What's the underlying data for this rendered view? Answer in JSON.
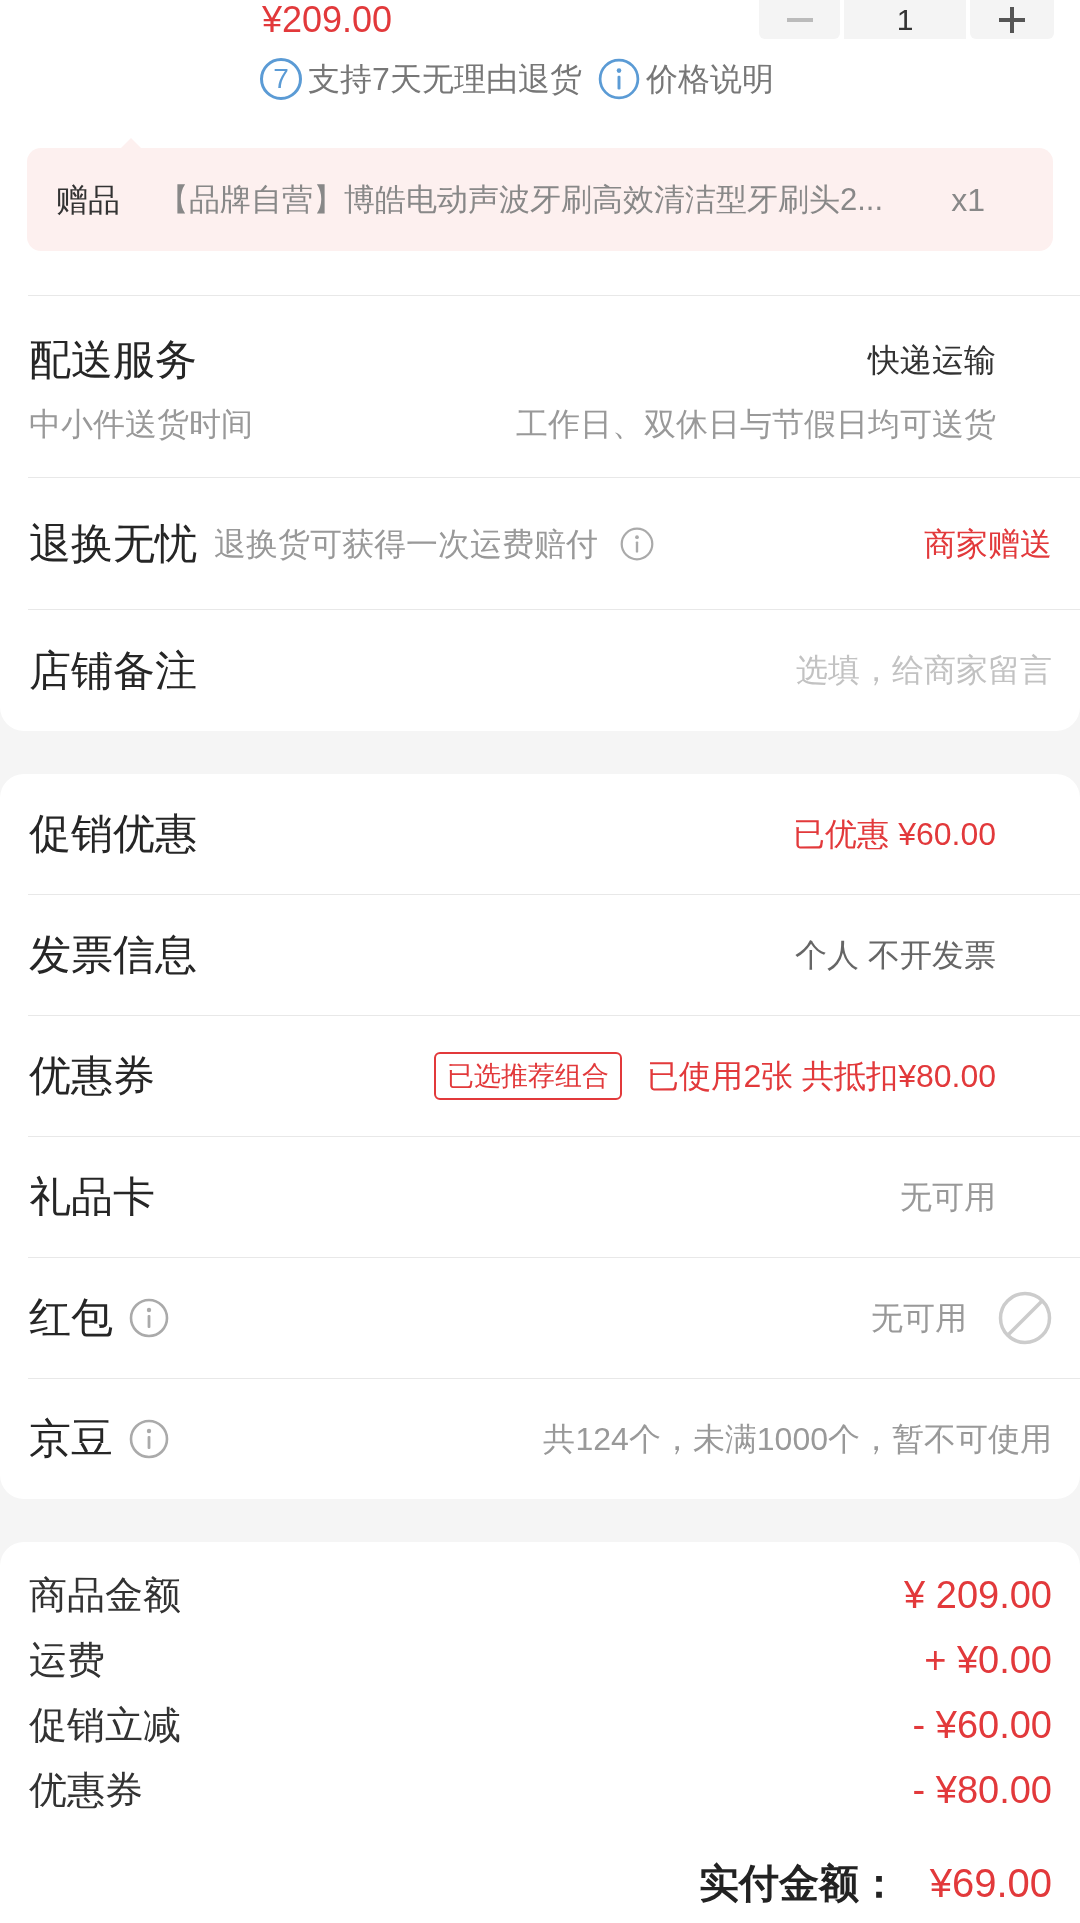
{
  "product": {
    "price": "¥209.00",
    "quantity": "1"
  },
  "service_tags": [
    {
      "kind": "badge",
      "badge": "7",
      "label": "支持7天无理由退货"
    },
    {
      "kind": "info",
      "label": "价格说明"
    }
  ],
  "gift": {
    "label": "赠品",
    "name": "【品牌自营】博皓电动声波牙刷高效清洁型牙刷头2...",
    "quantity": "x1"
  },
  "delivery": {
    "title": "配送服务",
    "value": "快递运输",
    "subtitle": "中小件送货时间",
    "note": "工作日、双休日与节假日均可送货"
  },
  "return_service": {
    "title": "退换无忧",
    "description": "退换货可获得一次运费赔付",
    "info": true,
    "value": "商家赠送"
  },
  "store_note": {
    "title": "店铺备注",
    "placeholder": "选填，给商家留言"
  },
  "benefits": [
    {
      "kind": "link",
      "label": "促销优惠",
      "info": false,
      "value": "已优惠 ¥60.00",
      "color": "#e2393b"
    },
    {
      "kind": "link",
      "label": "发票信息",
      "info": false,
      "value": "个人 不开发票",
      "color": "#666666"
    },
    {
      "kind": "link",
      "label": "优惠券",
      "info": false,
      "tag": "已选推荐组合",
      "value": "已使用2张 共抵扣¥80.00",
      "color": "#e2393b"
    },
    {
      "kind": "link",
      "label": "礼品卡",
      "info": false,
      "value": "无可用",
      "color": "#999999"
    },
    {
      "kind": "toggle",
      "label": "红包",
      "info": true,
      "value": "无可用",
      "color": "#999999",
      "disabled": true
    },
    {
      "kind": "plain",
      "label": "京豆",
      "info": true,
      "value": "共124个，未满1000个，暂不可使用",
      "color": "#999999"
    }
  ],
  "summary": {
    "lines": [
      {
        "label": "商品金额",
        "value": "¥ 209.00"
      },
      {
        "label": "运费",
        "value": "+ ¥0.00"
      },
      {
        "label": "促销立减",
        "value": "- ¥60.00"
      },
      {
        "label": "优惠券",
        "value": "- ¥80.00"
      }
    ],
    "total": {
      "label": "实付金额：",
      "value": "¥69.00"
    }
  }
}
